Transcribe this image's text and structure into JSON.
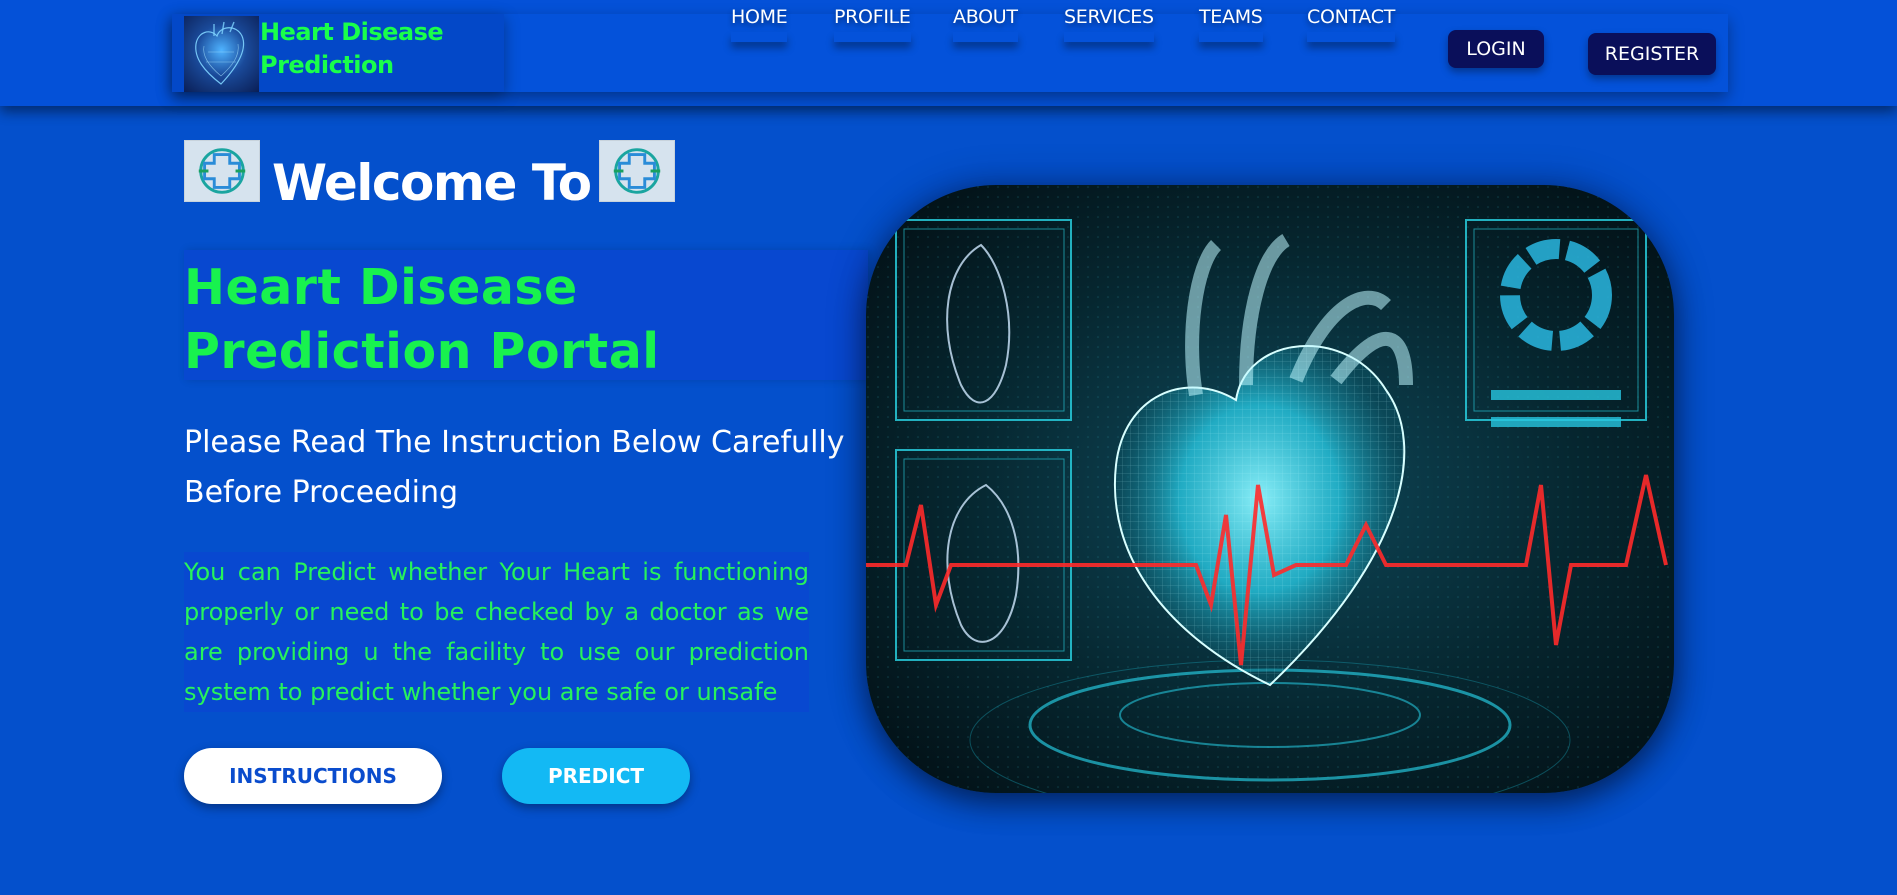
{
  "brand": {
    "logo_icon": "heart-mesh-logo",
    "name": "Heart Disease Prediction"
  },
  "nav": {
    "links": [
      "HOME",
      "PROFILE",
      "ABOUT",
      "SERVICES",
      "TEAMS",
      "CONTACT"
    ],
    "login_label": "LOGIN",
    "register_label": "REGISTER"
  },
  "hero": {
    "welcome_text": "Welcome To",
    "welcome_icon": "medical-cross-icon",
    "portal_title": "Heart Disease Prediction Portal",
    "instruction": "Please Read The Instruction Below Carefully Before Proceeding",
    "description": "You can Predict whether Your Heart is functioning properly or need to be checked by a doctor as we are providing u the facility to use our prediction system to predict whether you are safe or unsafe",
    "instructions_button": "INSTRUCTIONS",
    "predict_button": "PREDICT",
    "image_icon": "holographic-heart-illustration"
  },
  "colors": {
    "background": "#0450cc",
    "accent_green": "#18f24e",
    "button_dark": "#0a0f5a",
    "predict_blue": "#13b9f4",
    "ecg_red": "#ff2a2a"
  }
}
